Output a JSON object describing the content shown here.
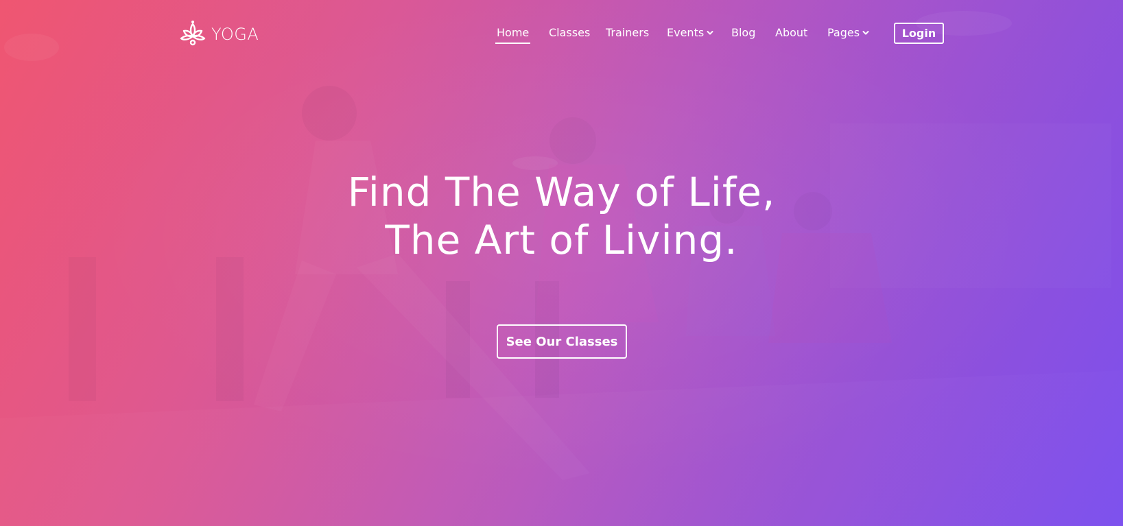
{
  "brand": {
    "name": "YOGA",
    "icon": "lotus-icon"
  },
  "nav": {
    "items": [
      {
        "label": "Home",
        "active": true
      },
      {
        "label": "Classes",
        "active": false
      },
      {
        "label": "Trainers",
        "active": false
      },
      {
        "label": "Events",
        "active": false,
        "icon": "chevron-down-icon"
      },
      {
        "label": "Blog",
        "active": false
      },
      {
        "label": "About",
        "active": false
      },
      {
        "label": "Pages",
        "active": false,
        "icon": "chevron-down-icon"
      }
    ],
    "login_label": "Login"
  },
  "hero": {
    "headline_line1": "Find The Way of Life,",
    "headline_line2": "The Art of Living.",
    "cta_label": "See Our Classes"
  },
  "colors": {
    "gradient_start": "#ef5470",
    "gradient_mid": "#bd56b8",
    "gradient_end": "#7b4cec",
    "text": "#ffffff"
  }
}
